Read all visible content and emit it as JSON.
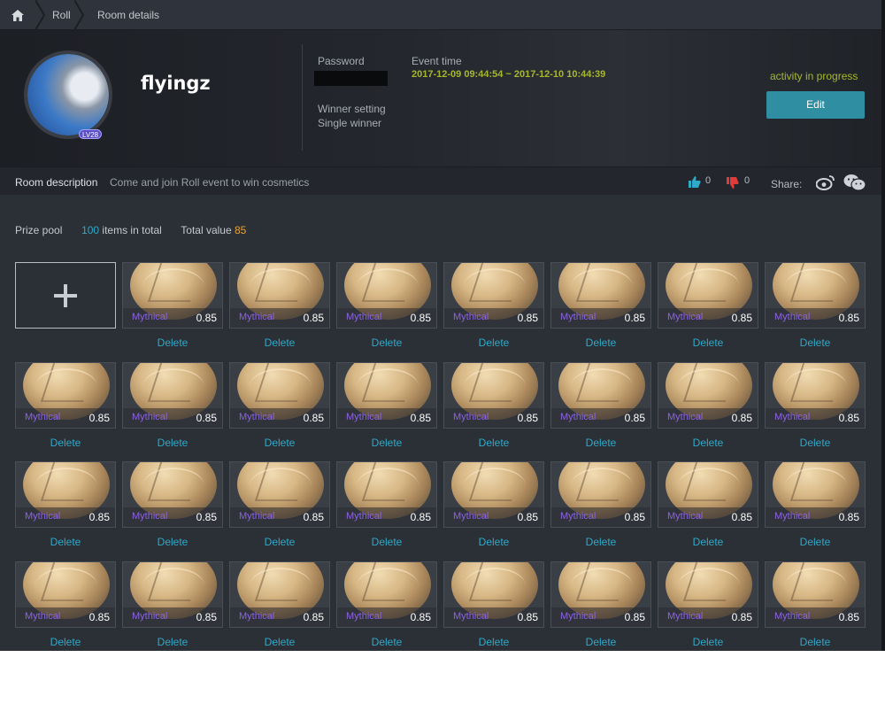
{
  "breadcrumb": {
    "items": [
      "Roll",
      "Room details"
    ]
  },
  "profile": {
    "username": "flyingz",
    "level": "LV28"
  },
  "room": {
    "password_label": "Password",
    "event_time_label": "Event time",
    "event_time": "2017-12-09 09:44:54 ~ 2017-12-10 10:44:39",
    "winner_setting_label": "Winner setting",
    "winner_setting": "Single winner",
    "status": "activity in progress",
    "edit_label": "Edit"
  },
  "description": {
    "label": "Room description",
    "text": "Come and join Roll event to win cosmetics",
    "likes": "0",
    "dislikes": "0",
    "share_label": "Share:"
  },
  "prize_pool": {
    "label": "Prize pool",
    "count": "100",
    "count_suffix": " items in total",
    "total_value_label": "Total value",
    "total_value": "85"
  },
  "item_template": {
    "rarity": "Mythical",
    "price": "0.85",
    "delete_label": "Delete"
  },
  "items": [
    {
      "rarity": "Mythical",
      "price": "0.85"
    },
    {
      "rarity": "Mythical",
      "price": "0.85"
    },
    {
      "rarity": "Mythical",
      "price": "0.85"
    },
    {
      "rarity": "Mythical",
      "price": "0.85"
    },
    {
      "rarity": "Mythical",
      "price": "0.85"
    },
    {
      "rarity": "Mythical",
      "price": "0.85"
    },
    {
      "rarity": "Mythical",
      "price": "0.85"
    },
    {
      "rarity": "Mythical",
      "price": "0.85"
    },
    {
      "rarity": "Mythical",
      "price": "0.85"
    },
    {
      "rarity": "Mythical",
      "price": "0.85"
    },
    {
      "rarity": "Mythical",
      "price": "0.85"
    },
    {
      "rarity": "Mythical",
      "price": "0.85"
    },
    {
      "rarity": "Mythical",
      "price": "0.85"
    },
    {
      "rarity": "Mythical",
      "price": "0.85"
    },
    {
      "rarity": "Mythical",
      "price": "0.85"
    },
    {
      "rarity": "Mythical",
      "price": "0.85"
    },
    {
      "rarity": "Mythical",
      "price": "0.85"
    },
    {
      "rarity": "Mythical",
      "price": "0.85"
    },
    {
      "rarity": "Mythical",
      "price": "0.85"
    },
    {
      "rarity": "Mythical",
      "price": "0.85"
    },
    {
      "rarity": "Mythical",
      "price": "0.85"
    },
    {
      "rarity": "Mythical",
      "price": "0.85"
    },
    {
      "rarity": "Mythical",
      "price": "0.85"
    },
    {
      "rarity": "Mythical",
      "price": "0.85"
    },
    {
      "rarity": "Mythical",
      "price": "0.85"
    },
    {
      "rarity": "Mythical",
      "price": "0.85"
    },
    {
      "rarity": "Mythical",
      "price": "0.85"
    },
    {
      "rarity": "Mythical",
      "price": "0.85"
    },
    {
      "rarity": "Mythical",
      "price": "0.85"
    },
    {
      "rarity": "Mythical",
      "price": "0.85"
    },
    {
      "rarity": "Mythical",
      "price": "0.85"
    }
  ],
  "colors": {
    "accent": "#2fa9c8",
    "status_green": "#a6b72d",
    "rarity_purple": "#8e62e6",
    "value_orange": "#e8a232",
    "button": "#2f8ea2"
  },
  "icons": [
    "home-icon",
    "add-icon",
    "thumbs-up-icon",
    "thumbs-down-icon",
    "weibo-icon",
    "wechat-icon"
  ]
}
